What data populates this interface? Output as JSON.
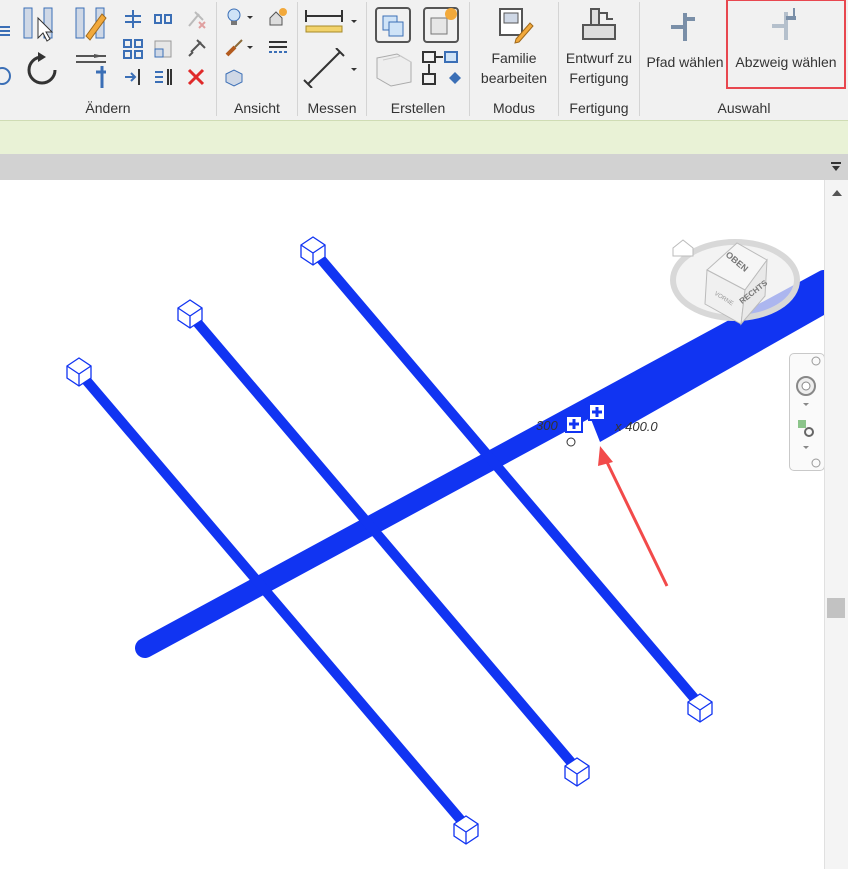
{
  "ribbon": {
    "panels": {
      "aendern": "Ändern",
      "ansicht": "Ansicht",
      "messen": "Messen",
      "erstellen": "Erstellen",
      "modus": "Modus",
      "fertigung": "Fertigung",
      "auswahl": "Auswahl"
    },
    "buttons": {
      "familie_line1": "Familie",
      "familie_line2": "bearbeiten",
      "entwurf_line1": "Entwurf zu",
      "entwurf_line2": "Fertigung",
      "pfad": "Pfad wählen",
      "abzweig": "Abzweig wählen"
    }
  },
  "viewcube": {
    "top": "OBEN",
    "right": "RECHTS",
    "front": "VORNE"
  },
  "dimensions": {
    "left": "300",
    "right": "x 400.0"
  },
  "colors": {
    "duct": "#1134f2",
    "highlight": "#e8474f",
    "annotation_arrow": "#f24a4a",
    "option_bar": "#e9f2d6"
  }
}
